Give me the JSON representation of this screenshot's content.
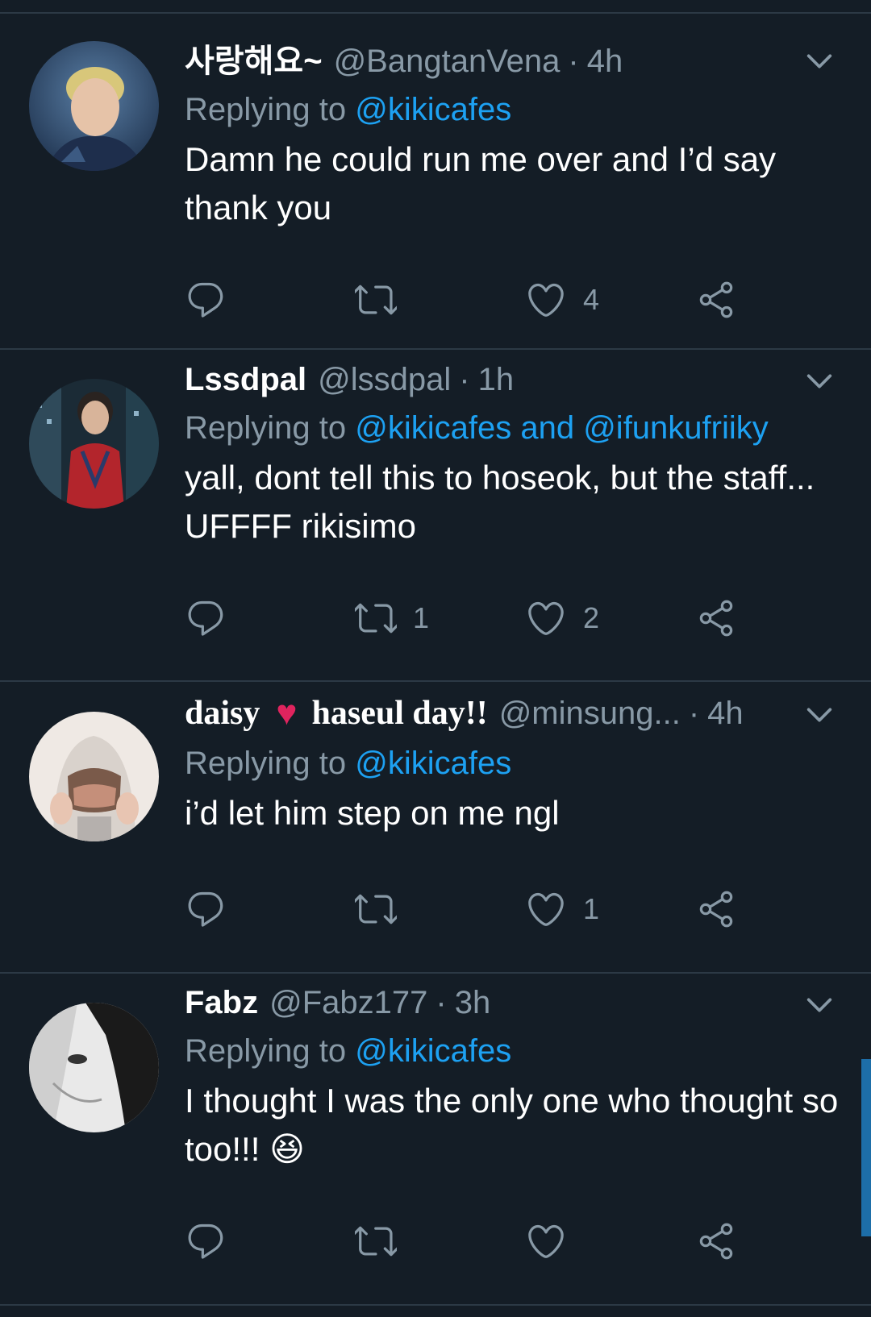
{
  "tweets": [
    {
      "name": "사랑해요~",
      "handle": "@BangtanVena",
      "time": "4h",
      "replying_prefix": "Replying to",
      "replying_to": "@kikicafes",
      "text": "Damn he could run me over and I’d say thank you",
      "reply_count": "",
      "retweet_count": "",
      "like_count": "4"
    },
    {
      "name": "Lssdpal",
      "handle": "@lssdpal",
      "time": "1h",
      "replying_prefix": "Replying to",
      "replying_to": "@kikicafes and @ifunkufriiky",
      "text": "yall, dont tell this to hoseok, but the staff... UFFFF rikisimo",
      "reply_count": "",
      "retweet_count": "1",
      "like_count": "2"
    },
    {
      "name_part1": "daisy",
      "name_part2": "haseul day!!",
      "name_heart_icon": "red-heart-icon",
      "handle": "@minsung...",
      "time": "4h",
      "replying_prefix": "Replying to",
      "replying_to": "@kikicafes",
      "text": "i’d let him step on me ngl",
      "reply_count": "",
      "retweet_count": "",
      "like_count": "1"
    },
    {
      "name": "Fabz",
      "handle": "@Fabz177",
      "time": "3h",
      "replying_prefix": "Replying to",
      "replying_to": "@kikicafes",
      "text": "I thought I was the only one who thought so too!!!",
      "emoji": "😆",
      "reply_count": "",
      "retweet_count": "",
      "like_count": ""
    }
  ],
  "icons": {
    "reply": "reply-icon",
    "retweet": "retweet-icon",
    "like": "heart-icon",
    "share": "share-icon",
    "menu": "chevron-down-icon"
  },
  "colors": {
    "background": "#141d26",
    "divider": "#2c3945",
    "secondary_text": "#8899a6",
    "link": "#1da1f2",
    "heart": "#e0245e"
  }
}
